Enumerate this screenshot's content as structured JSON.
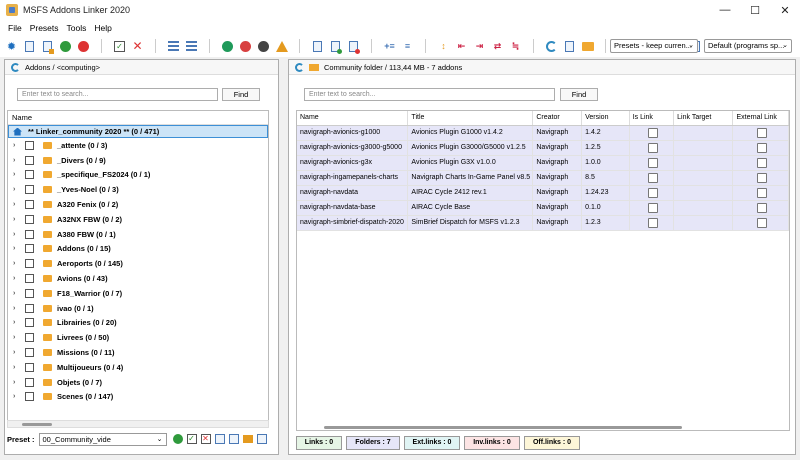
{
  "window": {
    "title": "MSFS Addons Linker 2020",
    "min": "—",
    "max": "☐",
    "close": "✕"
  },
  "menu": [
    "File",
    "Presets",
    "Tools",
    "Help"
  ],
  "toolbar": {
    "preset_mode": "Presets - keep curren...",
    "program_mode": "Default (programs sp..."
  },
  "left_panel": {
    "header": "Addons / <computing>",
    "search_placeholder": "Enter text to search...",
    "find_label": "Find",
    "column_name": "Name",
    "root_label": "** Linker_community 2020 ** (0 / 471)",
    "folders": [
      "_attente (0 / 3)",
      "_Divers (0 / 9)",
      "_specifique_FS2024 (0 / 1)",
      "_Yves-Noel (0 / 3)",
      "A320 Fenix (0 / 2)",
      "A32NX FBW (0 / 2)",
      "A380 FBW (0 / 1)",
      "Addons (0 / 15)",
      "Aeroports (0 / 145)",
      "Avions (0 / 43)",
      "F18_Warrior (0 / 7)",
      "ivao (0 / 1)",
      "Librairies (0 / 20)",
      "Livrees (0 / 50)",
      "Missions (0 / 11)",
      "Multijoueurs (0 / 4)",
      "Objets (0 / 7)",
      "Scenes (0 / 147)"
    ],
    "preset_label": "Preset :",
    "preset_value": "00_Community_vide"
  },
  "right_panel": {
    "header": "Community folder / 113,44 MB - 7 addons",
    "search_placeholder": "Enter text to search...",
    "find_label": "Find",
    "columns": [
      "Name",
      "Title",
      "Creator",
      "Version",
      "Is Link",
      "Link Target",
      "External Link"
    ],
    "rows": [
      {
        "name": "navigraph-avionics-g1000",
        "title": "Avionics Plugin G1000 v1.4.2",
        "creator": "Navigraph",
        "version": "1.4.2"
      },
      {
        "name": "navigraph-avionics-g3000-g5000",
        "title": "Avionics Plugin G3000/G5000 v1.2.5",
        "creator": "Navigraph",
        "version": "1.2.5"
      },
      {
        "name": "navigraph-avionics-g3x",
        "title": "Avionics Plugin G3X v1.0.0",
        "creator": "Navigraph",
        "version": "1.0.0"
      },
      {
        "name": "navigraph-ingamepanels-charts",
        "title": "Navigraph Charts In-Game Panel v8.5",
        "creator": "Navigraph",
        "version": "8.5"
      },
      {
        "name": "navigraph-navdata",
        "title": "AIRAC Cycle 2412 rev.1",
        "creator": "Navigraph",
        "version": "1.24.23"
      },
      {
        "name": "navigraph-navdata-base",
        "title": "AIRAC Cycle Base",
        "creator": "Navigraph",
        "version": "0.1.0"
      },
      {
        "name": "navigraph-simbrief-dispatch-2020",
        "title": "SimBrief Dispatch for MSFS v1.2.3",
        "creator": "Navigraph",
        "version": "1.2.3"
      }
    ]
  },
  "status": {
    "links": "Links : 0",
    "folders": "Folders : 7",
    "ext_links": "Ext.links : 0",
    "inv_links": "Inv.links : 0",
    "off_links": "Off.links : 0"
  },
  "colors": {
    "selected_row": "#cce4f7",
    "addon_row": "#e6e6f8",
    "links_bg": "#e6f5e6",
    "folders_bg": "#e6e6f8",
    "ext_bg": "#e0f4f4",
    "inv_bg": "#fce4e4",
    "off_bg": "#fdf6d8"
  }
}
